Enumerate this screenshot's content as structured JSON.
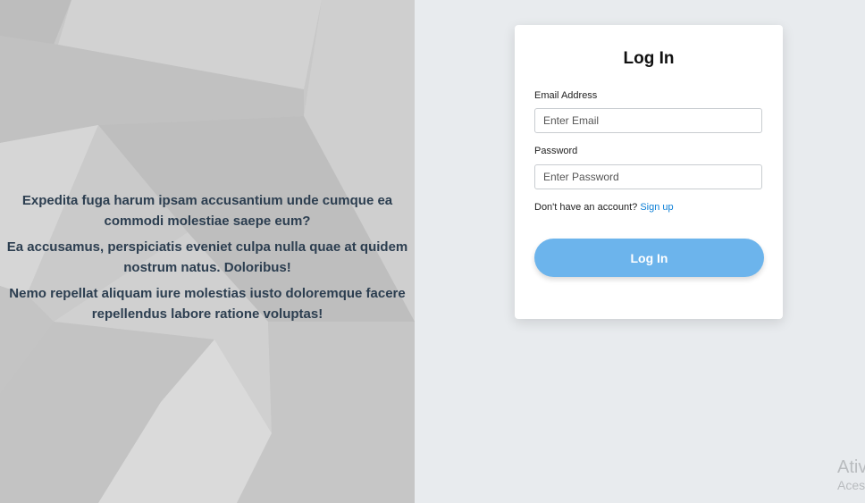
{
  "hero": {
    "paragraphs": [
      "Expedita fuga harum ipsam accusantium unde cumque ea commodi molestiae saepe eum?",
      "Ea accusamus, perspiciatis eveniet culpa nulla quae at quidem nostrum natus. Doloribus!",
      "Nemo repellat aliquam iure molestias iusto doloremque facere repellendus labore ratione voluptas!"
    ]
  },
  "login": {
    "title": "Log In",
    "email_label": "Email Address",
    "email_placeholder": "Enter Email",
    "password_label": "Password",
    "password_placeholder": "Enter Password",
    "no_account_text": "Don't have an account?",
    "signup_link": "Sign up",
    "button_label": "Log In"
  },
  "watermark": {
    "line1": "Ativ",
    "line2": "Aces"
  },
  "colors": {
    "page_background": "#e8ebee",
    "card_background": "#ffffff",
    "button_background": "#6cb4ec",
    "link": "#0d7fd6",
    "hero_text": "#2c3e50"
  }
}
